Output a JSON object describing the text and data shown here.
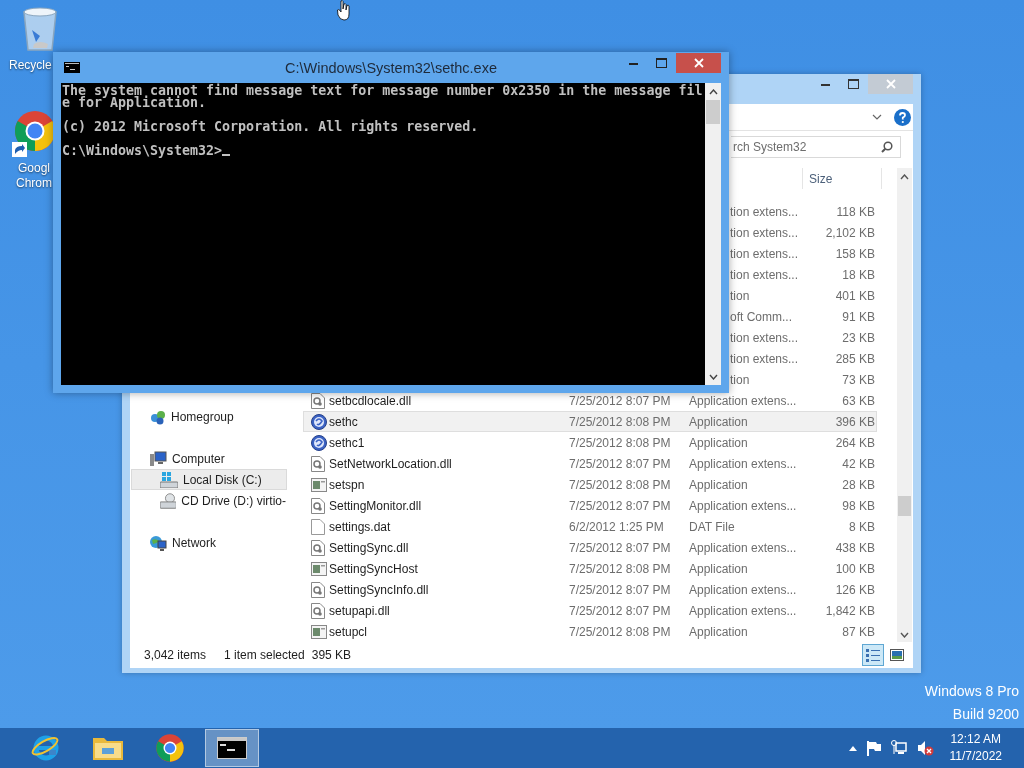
{
  "desktop": {
    "icons": [
      {
        "kind": "recycle",
        "label": "Recycle"
      },
      {
        "kind": "chrome",
        "label": "Googl Chrom"
      }
    ],
    "edition": "Windows 8 Pro",
    "build": "Build 9200"
  },
  "explorer": {
    "search": {
      "placeholder": "rch System32"
    },
    "size_header": "Size",
    "nav": [
      {
        "kind": "homegroup",
        "label": "Homegroup",
        "selected": false
      },
      {
        "kind": "computer",
        "label": "Computer",
        "selected": false,
        "children": [
          {
            "kind": "disk",
            "label": "Local Disk (C:)",
            "selected": true
          },
          {
            "kind": "cd",
            "label": "CD Drive (D:) virtio-",
            "selected": false
          }
        ]
      },
      {
        "kind": "network",
        "label": "Network",
        "selected": false
      }
    ],
    "files": [
      {
        "kind": "partial",
        "type": "tion extens...",
        "size": "118 KB",
        "selected": false
      },
      {
        "kind": "partial",
        "type": "tion extens...",
        "size": "2,102 KB",
        "selected": false
      },
      {
        "kind": "partial",
        "type": "tion extens...",
        "size": "158 KB",
        "selected": false
      },
      {
        "kind": "partial",
        "type": "tion extens...",
        "size": "18 KB",
        "selected": false
      },
      {
        "kind": "partial",
        "type": "tion",
        "size": "401 KB",
        "selected": false
      },
      {
        "kind": "partial",
        "type": "oft Comm...",
        "size": "91 KB",
        "selected": false
      },
      {
        "kind": "partial",
        "type": "tion extens...",
        "size": "23 KB",
        "selected": false
      },
      {
        "kind": "partial",
        "type": "tion extens...",
        "size": "285 KB",
        "selected": false
      },
      {
        "kind": "partial",
        "type": "tion",
        "size": "73 KB",
        "selected": false
      },
      {
        "kind": "dll",
        "name": "setbcdlocale.dll",
        "date": "7/25/2012 8:07 PM",
        "type": "Application extens...",
        "size": "63 KB",
        "selected": false
      },
      {
        "kind": "app",
        "name": "sethc",
        "date": "7/25/2012 8:08 PM",
        "type": "Application",
        "size": "396 KB",
        "selected": true
      },
      {
        "kind": "app",
        "name": "sethc1",
        "date": "7/25/2012 8:08 PM",
        "type": "Application",
        "size": "264 KB",
        "selected": false
      },
      {
        "kind": "dll",
        "name": "SetNetworkLocation.dll",
        "date": "7/25/2012 8:07 PM",
        "type": "Application extens...",
        "size": "42 KB",
        "selected": false
      },
      {
        "kind": "exe",
        "name": "setspn",
        "date": "7/25/2012 8:08 PM",
        "type": "Application",
        "size": "28 KB",
        "selected": false
      },
      {
        "kind": "dll",
        "name": "SettingMonitor.dll",
        "date": "7/25/2012 8:07 PM",
        "type": "Application extens...",
        "size": "98 KB",
        "selected": false
      },
      {
        "kind": "file",
        "name": "settings.dat",
        "date": "6/2/2012 1:25 PM",
        "type": "DAT File",
        "size": "8 KB",
        "selected": false
      },
      {
        "kind": "dll",
        "name": "SettingSync.dll",
        "date": "7/25/2012 8:07 PM",
        "type": "Application extens...",
        "size": "438 KB",
        "selected": false
      },
      {
        "kind": "exe",
        "name": "SettingSyncHost",
        "date": "7/25/2012 8:08 PM",
        "type": "Application",
        "size": "100 KB",
        "selected": false
      },
      {
        "kind": "dll",
        "name": "SettingSyncInfo.dll",
        "date": "7/25/2012 8:07 PM",
        "type": "Application extens...",
        "size": "126 KB",
        "selected": false
      },
      {
        "kind": "dll",
        "name": "setupapi.dll",
        "date": "7/25/2012 8:07 PM",
        "type": "Application extens...",
        "size": "1,842 KB",
        "selected": false
      },
      {
        "kind": "exe",
        "name": "setupcl",
        "date": "7/25/2012 8:08 PM",
        "type": "Application",
        "size": "87 KB",
        "selected": false
      }
    ],
    "status": {
      "count": "3,042 items",
      "selection": "1 item selected",
      "selection_size": "395 KB"
    },
    "views": [
      {
        "kind": "details",
        "selected": true
      },
      {
        "kind": "preview",
        "selected": false
      }
    ]
  },
  "console": {
    "title": "C:\\Windows\\System32\\sethc.exe",
    "lines": [
      {
        "text": "The system cannot find message text for message number 0x2350 in the message file for Application.",
        "cursor": false
      },
      {
        "text": "(c) 2012 Microsoft Corporation. All rights reserved.",
        "cursor": false
      },
      {
        "text": "C:\\Windows\\System32>",
        "cursor": true
      }
    ]
  },
  "taskbar": {
    "apps": [
      {
        "kind": "ie",
        "selected": false
      },
      {
        "kind": "folder",
        "selected": false
      },
      {
        "kind": "chrome",
        "selected": false
      },
      {
        "kind": "console",
        "selected": true
      }
    ],
    "clock": {
      "time": "12:12 AM",
      "date": "11/7/2022"
    }
  }
}
